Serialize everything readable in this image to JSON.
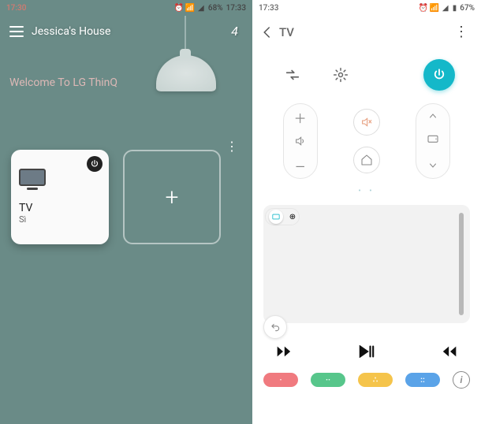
{
  "left": {
    "status": {
      "time": "17:30",
      "battery": "68%",
      "battery_time": "17:33"
    },
    "header": {
      "title": "Jessica's House",
      "notification": "4"
    },
    "welcome": "Welcome To LG ThinQ",
    "cards": {
      "tv": {
        "title": "TV",
        "subtitle": "Sì"
      }
    }
  },
  "right": {
    "status": {
      "time": "17:33",
      "battery": "67%"
    },
    "header": {
      "title": "TV"
    },
    "hotkeys": {
      "red": "·",
      "green": "··",
      "yellow": "∴",
      "blue": "::"
    }
  }
}
